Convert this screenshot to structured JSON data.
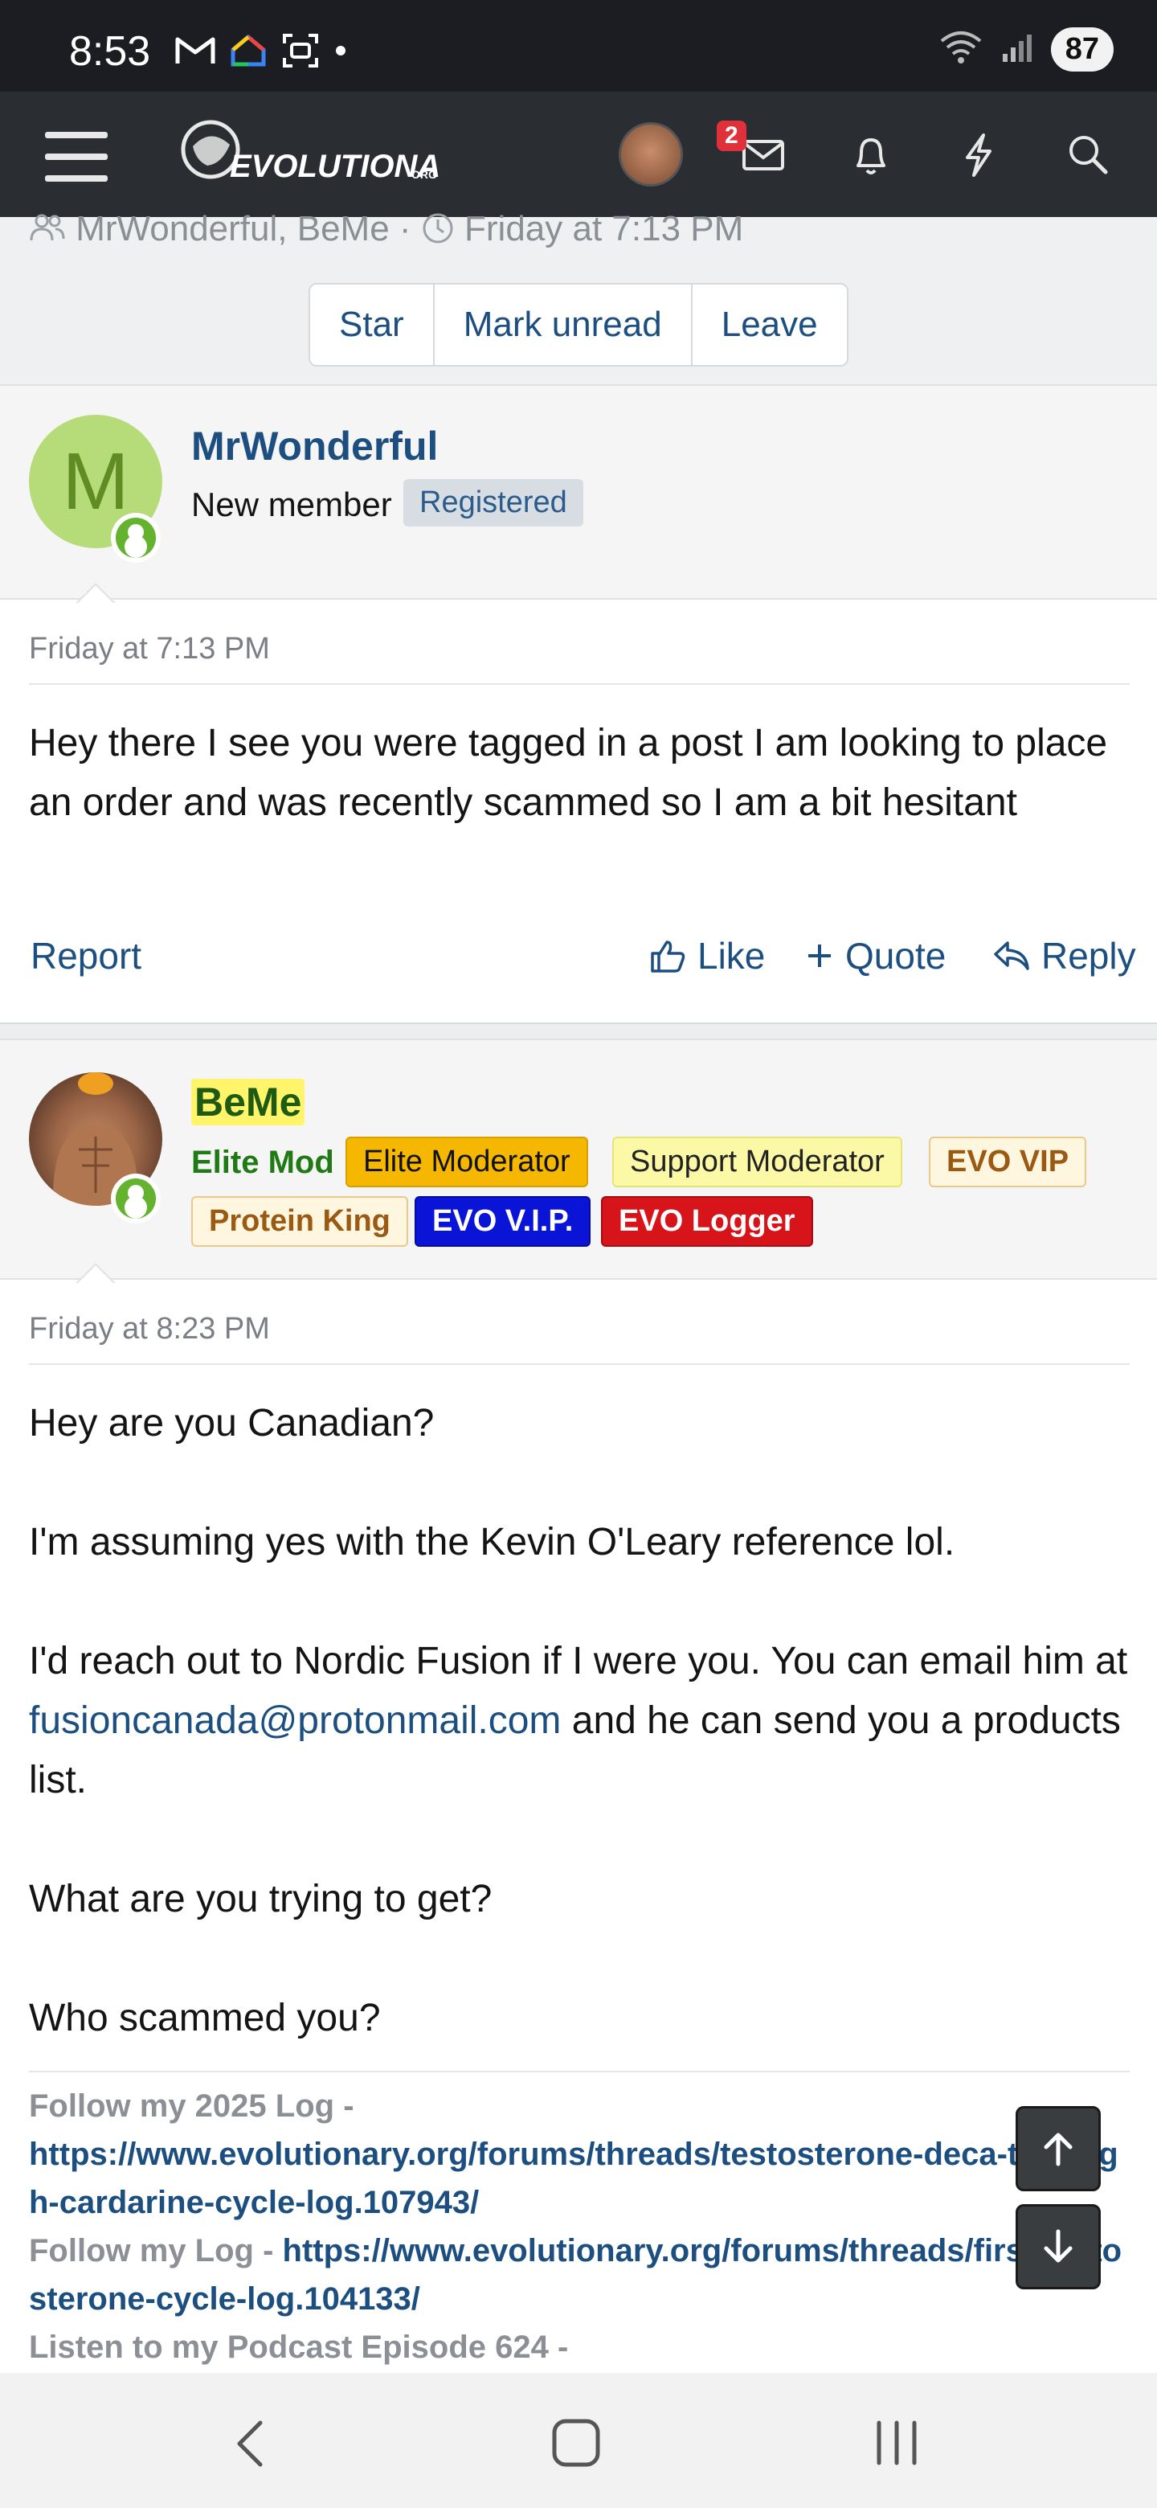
{
  "status_bar": {
    "time": "8:53",
    "battery": "87"
  },
  "header": {
    "logo_text": "EVOLUTIONARY",
    "logo_suffix": "ORG",
    "messages_badge": "2"
  },
  "thread_meta": {
    "participants": "MrWonderful, BeMe",
    "separator": "·",
    "date": "Friday at 7:13 PM",
    "buttons": [
      "Star",
      "Mark unread",
      "Leave"
    ]
  },
  "posts": [
    {
      "avatar_letter": "M",
      "username": "MrWonderful",
      "user_title": "New member",
      "banners": [
        "Registered"
      ],
      "date": "Friday at 7:13 PM",
      "body": "Hey there I see you were tagged in a post I am looking to place an order and was recently scammed so I am a bit hesitant",
      "actions": {
        "report": "Report",
        "like": "Like",
        "quote": "Quote",
        "reply": "Reply"
      }
    },
    {
      "username": "BeMe",
      "user_title": "Elite Mod",
      "banners": [
        "Elite Moderator",
        "Support Moderator",
        "EVO VIP",
        "Protein King",
        "EVO V.I.P.",
        "EVO Logger"
      ],
      "date": "Friday at 8:23 PM",
      "body": {
        "p1": "Hey are you Canadian?",
        "p2": "I'm assuming yes with the Kevin O'Leary reference lol.",
        "p3_a": "I'd reach out to Nordic Fusion if I were you. You can email him at ",
        "p3_link": "fusioncanada@protonmail.com",
        "p3_b": " and he can send you a products list.",
        "p4": "What are you trying to get?",
        "p5": "Who scammed you?"
      },
      "signature": {
        "line1_label": "Follow my 2025 Log -",
        "line1_link": "https://www.evolutionary.org/forums/threads/testosterone-deca-tren-hgh-cardarine-cycle-log.107943/",
        "line2_label": "Follow my Log -",
        "line2_link": "https://www.evolutionary.org/forums/threads/first-testosterone-cycle-log.104133/",
        "line3_label": "Listen to my Podcast Episode 624 -"
      }
    }
  ],
  "colors": {
    "link": "#1c4f80",
    "header_bg": "#2a2e33",
    "online": "#63b32e"
  }
}
